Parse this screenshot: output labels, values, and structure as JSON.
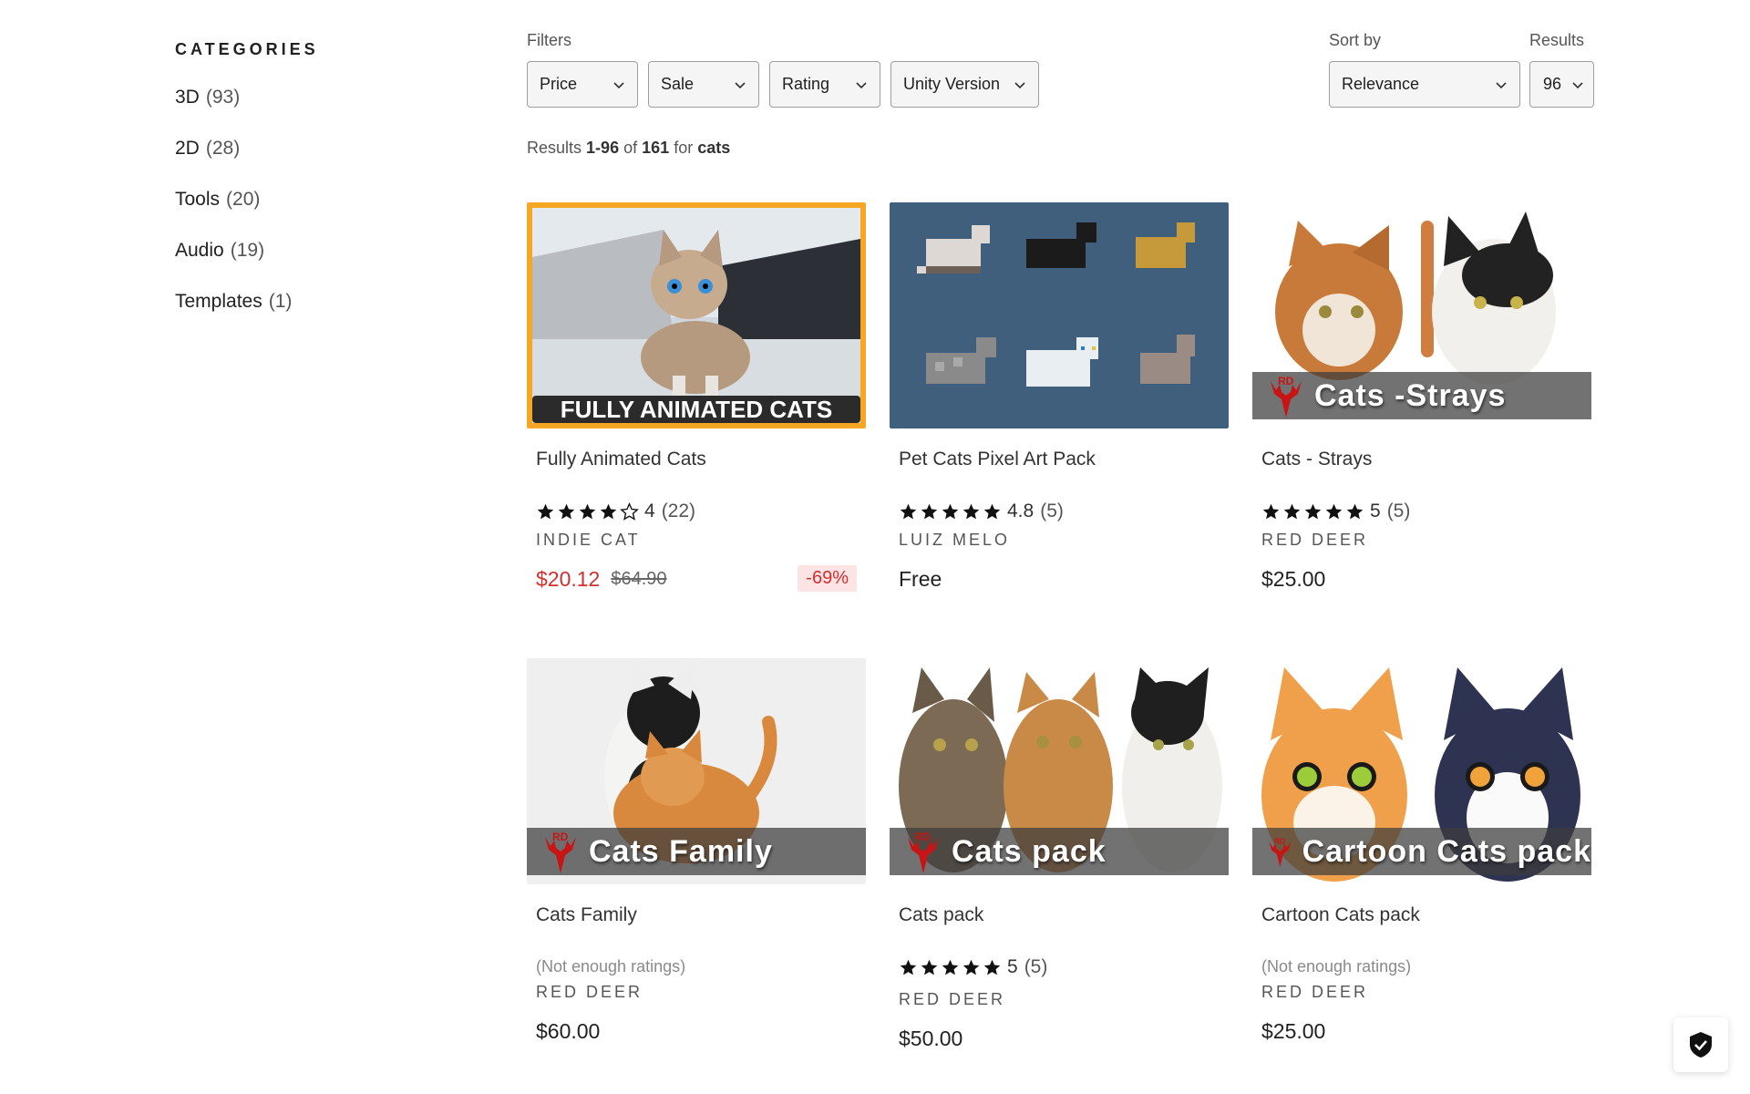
{
  "sidebar": {
    "heading": "CATEGORIES",
    "categories": [
      {
        "name": "3D",
        "count": "(93)"
      },
      {
        "name": "2D",
        "count": "(28)"
      },
      {
        "name": "Tools",
        "count": "(20)"
      },
      {
        "name": "Audio",
        "count": "(19)"
      },
      {
        "name": "Templates",
        "count": "(1)"
      }
    ]
  },
  "toolbar": {
    "filters_label": "Filters",
    "sort_label": "Sort by",
    "results_label": "Results",
    "filters": [
      "Price",
      "Sale",
      "Rating",
      "Unity Version"
    ],
    "sort_value": "Relevance",
    "results_value": "96"
  },
  "summary": {
    "prefix": "Results",
    "range": "1-96",
    "of": "of",
    "total": "161",
    "for": "for",
    "query": "cats"
  },
  "products": [
    {
      "title": "Fully Animated Cats",
      "thumbnail_text": "FULLY ANIMATED CATS",
      "stars": 4,
      "rating": "4",
      "rating_count": "(22)",
      "publisher": "INDIE CAT",
      "price": "$20.12",
      "original_price": "$64.90",
      "discount": "-69%"
    },
    {
      "title": "Pet Cats Pixel Art Pack",
      "stars": 5,
      "rating": "4.8",
      "rating_count": "(5)",
      "publisher": "LUIZ MELO",
      "price": "Free"
    },
    {
      "title": "Cats - Strays",
      "thumbnail_text": "Cats -Strays",
      "stars": 5,
      "rating": "5",
      "rating_count": "(5)",
      "publisher": "RED DEER",
      "price": "$25.00"
    },
    {
      "title": "Cats Family",
      "thumbnail_text": "Cats Family",
      "no_ratings": "(Not enough ratings)",
      "publisher": "RED DEER",
      "price": "$60.00"
    },
    {
      "title": "Cats pack",
      "thumbnail_text": "Cats pack",
      "stars": 5,
      "rating": "5",
      "rating_count": "(5)",
      "publisher": "RED DEER",
      "price": "$50.00"
    },
    {
      "title": "Cartoon Cats pack",
      "thumbnail_text": "Cartoon Cats pack",
      "no_ratings": "(Not enough ratings)",
      "publisher": "RED DEER",
      "price": "$25.00"
    }
  ],
  "colors": {
    "sale_red": "#d32f2f",
    "discount_bg": "#fde4e4",
    "featured_border": "#f5a623",
    "pixel_bg": "#3f5f7d"
  }
}
